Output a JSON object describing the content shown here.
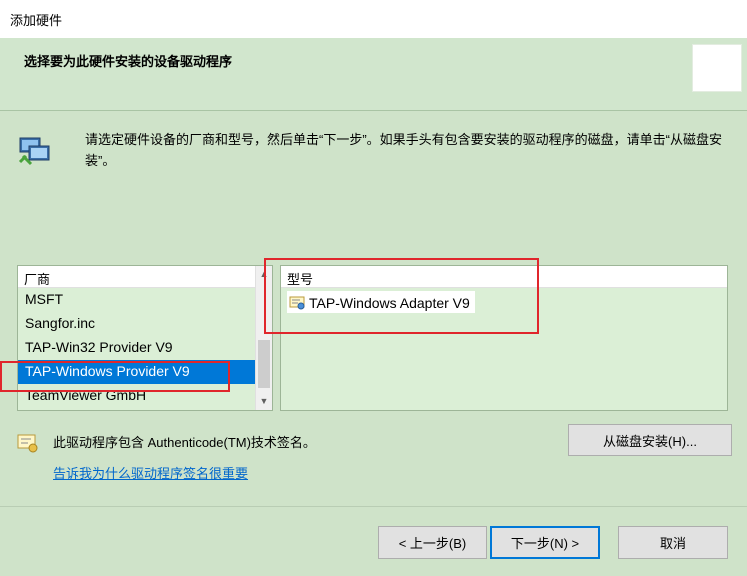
{
  "window": {
    "title": "添加硬件"
  },
  "header": {
    "title": "选择要为此硬件安装的设备驱动程序"
  },
  "intro": {
    "text": "请选定硬件设备的厂商和型号，然后单击“下一步”。如果手头有包含要安装的驱动程序的磁盘，请单击“从磁盘安装”。"
  },
  "manufacturer": {
    "header": "厂商",
    "items": [
      "MSFT",
      "Sangfor.inc",
      "TAP-Win32 Provider V9",
      "TAP-Windows Provider V9",
      "TeamViewer GmbH"
    ],
    "selected_index": 3
  },
  "model": {
    "header": "型号",
    "items": [
      "TAP-Windows Adapter V9"
    ]
  },
  "signature": {
    "text": "此驱动程序包含 Authenticode(TM)技术签名。",
    "link": "告诉我为什么驱动程序签名很重要"
  },
  "buttons": {
    "have_disk": "从磁盘安装(H)...",
    "back": "< 上一步(B)",
    "next": "下一步(N) >",
    "cancel": "取消"
  },
  "colors": {
    "background": "#cfe3c9",
    "selection": "#0078d7",
    "annotation": "#e0262c",
    "link": "#0066cc"
  }
}
